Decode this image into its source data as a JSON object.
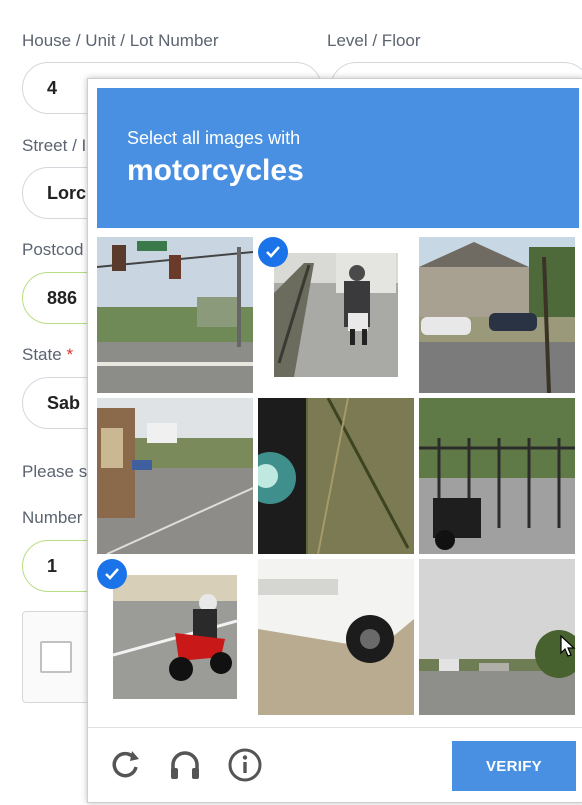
{
  "form": {
    "house_label": "House / Unit / Lot Number",
    "house_value": "4",
    "level_label": "Level / Floor",
    "street_label": "Street / I",
    "street_value": "Lorc",
    "postcode_label": "Postcod",
    "postcode_value": "886",
    "state_label": "State",
    "state_required": "*",
    "state_value": "Sab",
    "please_text": "Please s",
    "number_label": "Number",
    "number_value": "1"
  },
  "captcha": {
    "prompt_small": "Select all images with",
    "prompt_big": "motorcycles",
    "verify_label": "VERIFY",
    "tiles": [
      {
        "name": "traffic-lights-street",
        "selected": false
      },
      {
        "name": "motorcycle-rider-street",
        "selected": true
      },
      {
        "name": "houses-road",
        "selected": false
      },
      {
        "name": "bus-stop-street",
        "selected": false
      },
      {
        "name": "traffic-light-closeup",
        "selected": false
      },
      {
        "name": "fence-motorcycle",
        "selected": false
      },
      {
        "name": "red-sport-motorcycle",
        "selected": true
      },
      {
        "name": "white-car-closeup",
        "selected": false
      },
      {
        "name": "cloudy-road-trees",
        "selected": false
      }
    ],
    "colors": {
      "banner": "#4a90e2",
      "check": "#1a73e8",
      "verify": "#4a90e2"
    }
  }
}
